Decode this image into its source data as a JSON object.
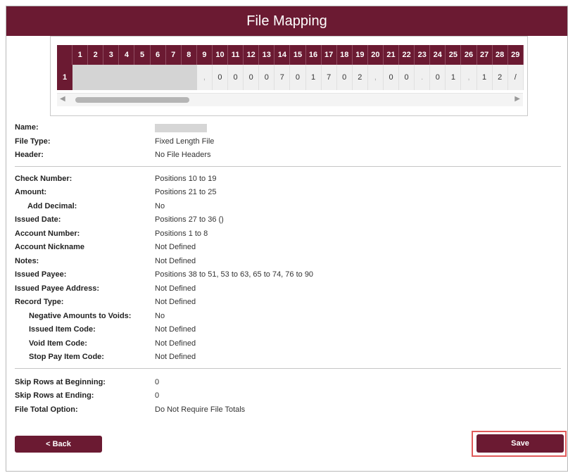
{
  "header": {
    "title": "File Mapping"
  },
  "grid": {
    "columns": [
      "1",
      "2",
      "3",
      "4",
      "5",
      "6",
      "7",
      "8",
      "9",
      "10",
      "11",
      "12",
      "13",
      "14",
      "15",
      "16",
      "17",
      "18",
      "19",
      "20",
      "21",
      "22",
      "23",
      "24",
      "25",
      "26",
      "27",
      "28",
      "29"
    ],
    "row_number": "1",
    "cells": [
      "",
      "",
      "",
      "",
      "",
      "",
      "",
      "",
      ",",
      "0",
      "0",
      "0",
      "0",
      "7",
      "0",
      "1",
      "7",
      "0",
      "2",
      ",",
      "0",
      "0",
      ".",
      "0",
      "1",
      ",",
      "1",
      "2",
      "/"
    ]
  },
  "details": {
    "name_label": "Name:",
    "name_value": "",
    "file_type_label": "File Type:",
    "file_type_value": "Fixed Length File",
    "header_label": "Header:",
    "header_value": "No File Headers",
    "check_number_label": "Check Number:",
    "check_number_value": "Positions 10 to 19",
    "amount_label": "Amount:",
    "amount_value": "Positions 21 to 25",
    "add_decimal_label": "Add Decimal:",
    "add_decimal_value": "No",
    "issued_date_label": "Issued Date:",
    "issued_date_value": "Positions 27 to 36 ()",
    "account_number_label": "Account Number:",
    "account_number_value": "Positions 1 to 8",
    "account_nickname_label": "Account Nickname",
    "account_nickname_value": "Not Defined",
    "notes_label": "Notes:",
    "notes_value": "Not Defined",
    "issued_payee_label": "Issued Payee:",
    "issued_payee_value": "Positions 38 to 51, 53 to 63, 65 to 74, 76 to 90",
    "issued_payee_address_label": "Issued Payee Address:",
    "issued_payee_address_value": "Not Defined",
    "record_type_label": "Record Type:",
    "record_type_value": "Not Defined",
    "negative_amounts_label": "Negative Amounts to Voids:",
    "negative_amounts_value": "No",
    "issued_item_code_label": "Issued Item Code:",
    "issued_item_code_value": "Not Defined",
    "void_item_code_label": "Void Item Code:",
    "void_item_code_value": "Not Defined",
    "stop_pay_item_code_label": "Stop Pay Item Code:",
    "stop_pay_item_code_value": "Not Defined",
    "skip_rows_beginning_label": "Skip Rows at Beginning:",
    "skip_rows_beginning_value": "0",
    "skip_rows_ending_label": "Skip Rows at Ending:",
    "skip_rows_ending_value": "0",
    "file_total_option_label": "File Total Option:",
    "file_total_option_value": "Do Not Require File Totals"
  },
  "buttons": {
    "back_label": "< Back",
    "save_label": "Save"
  },
  "colors": {
    "brand": "#6b1a32",
    "highlight": "#e05a5a"
  },
  "icons": {
    "scroll_left": "triangle-left",
    "scroll_right": "triangle-right"
  }
}
